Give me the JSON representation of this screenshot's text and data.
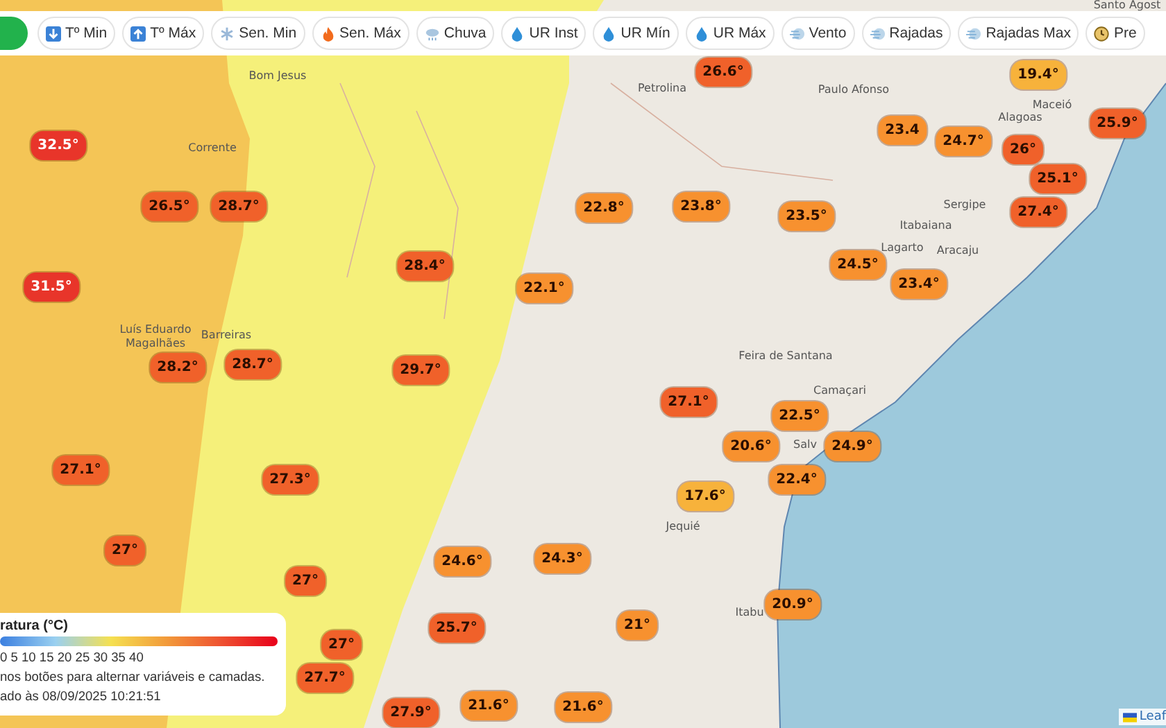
{
  "toolbar": {
    "buttons": [
      {
        "kind": "home"
      },
      {
        "kind": "down",
        "label": "Tº Min"
      },
      {
        "kind": "up",
        "label": "Tº Máx"
      },
      {
        "kind": "snow",
        "label": "Sen. Min"
      },
      {
        "kind": "fire",
        "label": "Sen. Máx"
      },
      {
        "kind": "rain",
        "label": "Chuva"
      },
      {
        "kind": "drop",
        "label": "UR Inst"
      },
      {
        "kind": "drop",
        "label": "UR Mín"
      },
      {
        "kind": "drop",
        "label": "UR Máx"
      },
      {
        "kind": "wind",
        "label": "Vento"
      },
      {
        "kind": "wind",
        "label": "Rajadas"
      },
      {
        "kind": "wind",
        "label": "Rajadas Max"
      },
      {
        "kind": "clock",
        "label": "Pre"
      }
    ]
  },
  "map": {
    "places": [
      "Bom Jesus",
      "Petrolina",
      "Paulo Afonso",
      "Santo Agost",
      "Maceió",
      "Alagoas",
      "Sergipe",
      "Itabaiana",
      "Lagarto",
      "Aracaju",
      "Corrente",
      "Luís Eduardo",
      "Magalhães",
      "Barreiras",
      "Feira de Santana",
      "Camaçari",
      "Salv",
      "Jequié",
      "Itabu"
    ],
    "markers": [
      {
        "value": "32.5°",
        "color": "#e8352a"
      },
      {
        "value": "26.5°",
        "color": "#f0612a"
      },
      {
        "value": "28.7°",
        "color": "#f0612a"
      },
      {
        "value": "31.5°",
        "color": "#e8352a"
      },
      {
        "value": "28.2°",
        "color": "#f0612a"
      },
      {
        "value": "28.7°",
        "color": "#f0612a"
      },
      {
        "value": "27.1°",
        "color": "#f0612a"
      },
      {
        "value": "27°",
        "color": "#f0612a"
      },
      {
        "value": "27.3°",
        "color": "#f0612a"
      },
      {
        "value": "28.4°",
        "color": "#f0612a"
      },
      {
        "value": "22.1°",
        "color": "#f7912f"
      },
      {
        "value": "29.7°",
        "color": "#f0612a"
      },
      {
        "value": "27°",
        "color": "#f0612a"
      },
      {
        "value": "27°",
        "color": "#f0612a"
      },
      {
        "value": "27.7°",
        "color": "#f0612a"
      },
      {
        "value": "27.9°",
        "color": "#f0612a"
      },
      {
        "value": "21.6°",
        "color": "#f7912f"
      },
      {
        "value": "21.6°",
        "color": "#f7912f"
      },
      {
        "value": "24.6°",
        "color": "#f7912f"
      },
      {
        "value": "24.3°",
        "color": "#f7912f"
      },
      {
        "value": "25.7°",
        "color": "#f0612a"
      },
      {
        "value": "26.6°",
        "color": "#f0612a"
      },
      {
        "value": "19.4°",
        "color": "#f7b23b"
      },
      {
        "value": "22.8°",
        "color": "#f7912f"
      },
      {
        "value": "23.8°",
        "color": "#f7912f"
      },
      {
        "value": "23.5°",
        "color": "#f7912f"
      },
      {
        "value": "23.4",
        "color": "#f7912f"
      },
      {
        "value": "24.7°",
        "color": "#f7912f"
      },
      {
        "value": "26°",
        "color": "#f0612a"
      },
      {
        "value": "25.9°",
        "color": "#f0612a"
      },
      {
        "value": "25.1°",
        "color": "#f0612a"
      },
      {
        "value": "27.4°",
        "color": "#f0612a"
      },
      {
        "value": "24.5°",
        "color": "#f7912f"
      },
      {
        "value": "23.4°",
        "color": "#f7912f"
      },
      {
        "value": "27.1°",
        "color": "#f0612a"
      },
      {
        "value": "22.5°",
        "color": "#f7912f"
      },
      {
        "value": "24.9°",
        "color": "#f7912f"
      },
      {
        "value": "20.6°",
        "color": "#f7912f"
      },
      {
        "value": "22.4°",
        "color": "#f7912f"
      },
      {
        "value": "17.6°",
        "color": "#f7b23b"
      },
      {
        "value": "20.9°",
        "color": "#f7912f"
      },
      {
        "value": "21°",
        "color": "#f7912f"
      }
    ]
  },
  "legend": {
    "title": "ratura (°C)",
    "scale": "0 5 10 15 20 25 30 35 40",
    "hint": "nos botões para alternar variáveis e camadas.",
    "updated": "ado às 08/09/2025 10:21:51"
  },
  "attribution": "Leaf"
}
